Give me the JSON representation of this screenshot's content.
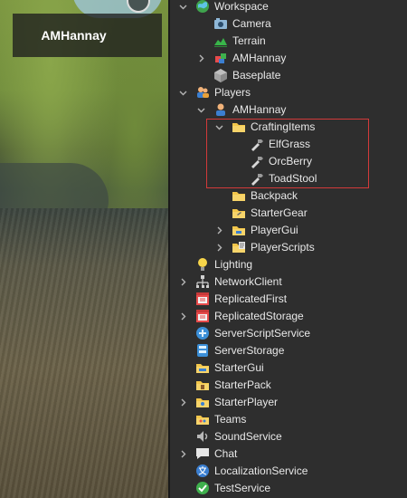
{
  "viewport": {
    "player_name": "AMHannay"
  },
  "explorer": {
    "items": [
      {
        "label": "Workspace",
        "icon": "workspace-icon",
        "depth": 0,
        "chevron": "expanded"
      },
      {
        "label": "Camera",
        "icon": "camera-icon",
        "depth": 1,
        "chevron": "none"
      },
      {
        "label": "Terrain",
        "icon": "terrain-icon",
        "depth": 1,
        "chevron": "none"
      },
      {
        "label": "AMHannay",
        "icon": "model-icon",
        "depth": 1,
        "chevron": "collapsed"
      },
      {
        "label": "Baseplate",
        "icon": "part-icon",
        "depth": 1,
        "chevron": "none"
      },
      {
        "label": "Players",
        "icon": "players-icon",
        "depth": 0,
        "chevron": "expanded"
      },
      {
        "label": "AMHannay",
        "icon": "player-icon",
        "depth": 1,
        "chevron": "expanded"
      },
      {
        "label": "CraftingItems",
        "icon": "folder-icon",
        "depth": 2,
        "chevron": "expanded"
      },
      {
        "label": "ElfGrass",
        "icon": "tool-icon",
        "depth": 3,
        "chevron": "none"
      },
      {
        "label": "OrcBerry",
        "icon": "tool-icon",
        "depth": 3,
        "chevron": "none"
      },
      {
        "label": "ToadStool",
        "icon": "tool-icon",
        "depth": 3,
        "chevron": "none"
      },
      {
        "label": "Backpack",
        "icon": "backpack-folder-icon",
        "depth": 2,
        "chevron": "none"
      },
      {
        "label": "StarterGear",
        "icon": "starter-gear-icon",
        "depth": 2,
        "chevron": "none"
      },
      {
        "label": "PlayerGui",
        "icon": "player-gui-icon",
        "depth": 2,
        "chevron": "collapsed"
      },
      {
        "label": "PlayerScripts",
        "icon": "player-scripts-icon",
        "depth": 2,
        "chevron": "collapsed"
      },
      {
        "label": "Lighting",
        "icon": "lighting-icon",
        "depth": 0,
        "chevron": "none"
      },
      {
        "label": "NetworkClient",
        "icon": "network-client-icon",
        "depth": 0,
        "chevron": "collapsed"
      },
      {
        "label": "ReplicatedFirst",
        "icon": "replicated-first-icon",
        "depth": 0,
        "chevron": "none"
      },
      {
        "label": "ReplicatedStorage",
        "icon": "replicated-storage-icon",
        "depth": 0,
        "chevron": "collapsed"
      },
      {
        "label": "ServerScriptService",
        "icon": "server-script-service-icon",
        "depth": 0,
        "chevron": "none"
      },
      {
        "label": "ServerStorage",
        "icon": "server-storage-icon",
        "depth": 0,
        "chevron": "none"
      },
      {
        "label": "StarterGui",
        "icon": "starter-gui-icon",
        "depth": 0,
        "chevron": "none"
      },
      {
        "label": "StarterPack",
        "icon": "starter-pack-icon",
        "depth": 0,
        "chevron": "none"
      },
      {
        "label": "StarterPlayer",
        "icon": "starter-player-icon",
        "depth": 0,
        "chevron": "collapsed"
      },
      {
        "label": "Teams",
        "icon": "teams-icon",
        "depth": 0,
        "chevron": "none"
      },
      {
        "label": "SoundService",
        "icon": "sound-service-icon",
        "depth": 0,
        "chevron": "none"
      },
      {
        "label": "Chat",
        "icon": "chat-icon",
        "depth": 0,
        "chevron": "collapsed"
      },
      {
        "label": "LocalizationService",
        "icon": "localization-service-icon",
        "depth": 0,
        "chevron": "none"
      },
      {
        "label": "TestService",
        "icon": "test-service-icon",
        "depth": 0,
        "chevron": "none"
      }
    ],
    "highlight_color": "#d23a3a"
  }
}
